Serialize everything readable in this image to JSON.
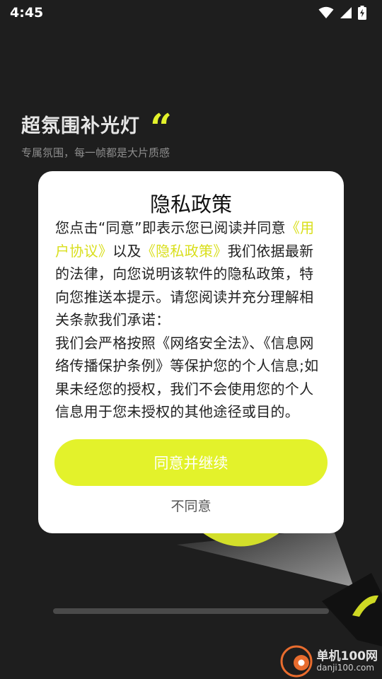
{
  "status_bar": {
    "time": "4:45",
    "icons": [
      "wifi-icon",
      "signal-icon",
      "battery-charging-icon"
    ]
  },
  "background": {
    "headline": "超氛围补光灯",
    "quote_mark": "“",
    "subline": "专属氛围，每一帧都是大片质感"
  },
  "colors": {
    "accent": "#e3f22b",
    "link": "#d9df1c",
    "background": "#1e1e1e",
    "dialog": "#ffffff"
  },
  "dialog": {
    "title": "隐私政策",
    "body_part1": "您点击“同意”即表示您已阅读并同意",
    "link_user_agreement": "《用户协议》",
    "body_part2": "以及",
    "link_privacy_policy": "《隐私政策》",
    "body_part3": "我们依据最新的法律，向您说明该软件的隐私政策，特向您推送本提示。请您阅读并充分理解相关条款我们承诺：",
    "body_part4": "我们会严格按照《网络安全法》、《信息网络传播保护条例》等保护您的个人信息;如果未经您的授权，我们不会使用您的个人信息用于您未授权的其他途径或目的。",
    "agree_label": "同意并继续",
    "decline_label": "不同意"
  },
  "watermark": {
    "name": "单机100网",
    "url": "danji100.com"
  }
}
